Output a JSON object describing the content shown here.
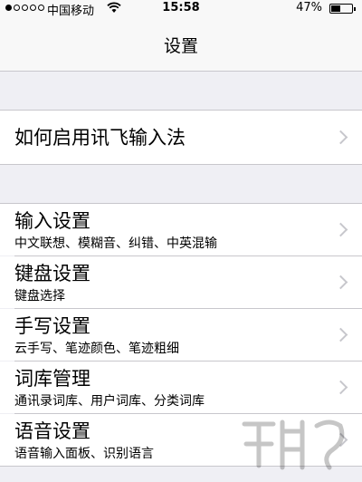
{
  "status_bar": {
    "carrier": "中国移动",
    "time": "15:58",
    "battery": "47%",
    "battery_level": 0.47,
    "signal_bars_filled": 1,
    "signal_bars_total": 5
  },
  "nav": {
    "title": "设置"
  },
  "sections": {
    "setup": {
      "title": "如何启用讯飞输入法"
    },
    "items": [
      {
        "title": "输入设置",
        "subtitle": "中文联想、模糊音、纠错、中英混输"
      },
      {
        "title": "键盘设置",
        "subtitle": "键盘选择"
      },
      {
        "title": "手写设置",
        "subtitle": "云手写、笔迹颜色、笔迹粗细"
      },
      {
        "title": "词库管理",
        "subtitle": "通讯录词库、用户词库、分类词库"
      },
      {
        "title": "语音设置",
        "subtitle": "语音输入面板、识别语言"
      }
    ]
  },
  "icons": {
    "chevron": "chevron-right-icon",
    "wifi": "wifi-icon",
    "battery": "battery-icon"
  },
  "colors": {
    "background": "#efeff4",
    "cell": "#ffffff",
    "separator": "#c8c7cc",
    "chevron": "#c7c7cc"
  }
}
